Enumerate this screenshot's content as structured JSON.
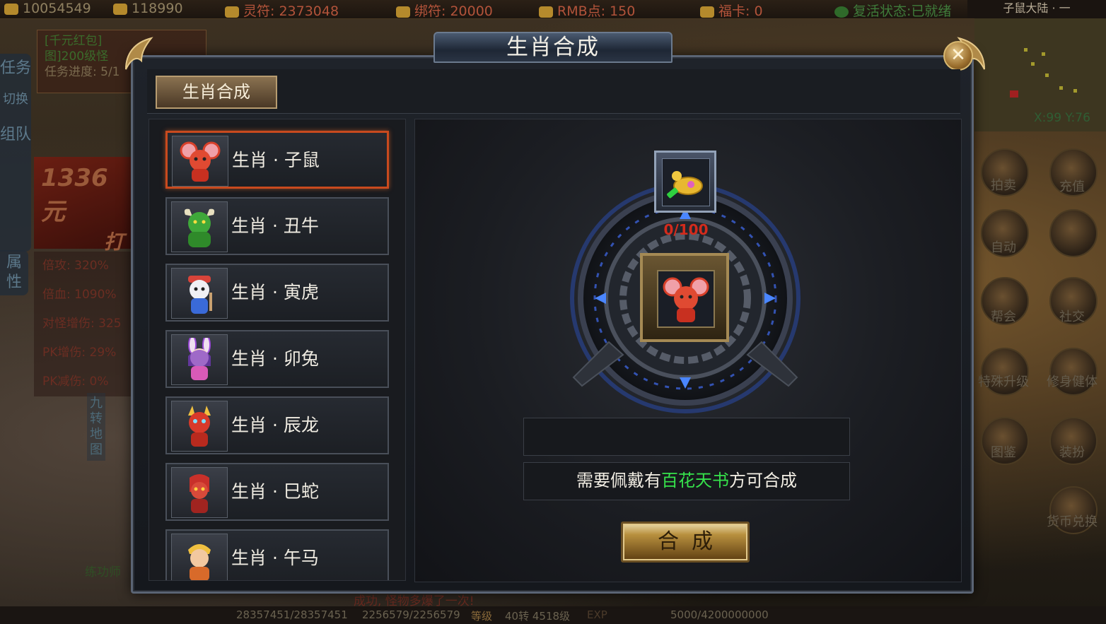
{
  "topbar": {
    "gold": "10054549",
    "ingot": "118990",
    "lingfu": "灵符: 2373048",
    "bangfu": "绑符: 20000",
    "rmb": "RMB点: 150",
    "fuka": "福卡: 0",
    "revive": "复活状态:已就绪",
    "server": "子鼠大陆 · 一"
  },
  "lefthud": {
    "btn_task": "任务",
    "btn_switch": "切换",
    "btn_team": "组队",
    "btn_attr": "属性",
    "quest_line1": "[千元红包]",
    "quest_line2": "图]200级怪",
    "quest_line3": "任务进度: 5/1",
    "banner": "1336元",
    "banner2": "打",
    "stats": [
      "倍攻: 320%",
      "倍血: 1090%",
      "对怪增伤: 325",
      "PK增伤: 29%",
      "PK减伤: 0%"
    ],
    "map_label": "九转地图",
    "chat": "练功师"
  },
  "righthud": {
    "coords": "X:99 Y:76",
    "buttons": [
      "拍卖",
      "充值",
      "自动",
      "",
      "帮会",
      "社交",
      "特殊升级",
      "修身健体",
      "图鉴",
      "装扮",
      "货币兑换"
    ]
  },
  "bottombar": {
    "hp": "28357451/28357451",
    "mp": "2256579/2256579",
    "level_label": "等级",
    "level": "40转 4518级",
    "exp_label": "EXP",
    "exp": "5000/4200000000",
    "system_msg": "成功, 怪物多爆了一次!"
  },
  "dialog": {
    "title": "生肖合成",
    "close": "✕",
    "tab": "生肖合成",
    "list": [
      {
        "label": "生肖 · 子鼠",
        "color": "#d8402a",
        "selected": true
      },
      {
        "label": "生肖 · 丑牛",
        "color": "#3fa83a",
        "selected": false
      },
      {
        "label": "生肖 · 寅虎",
        "color": "#d8443a",
        "selected": false
      },
      {
        "label": "生肖 · 卯兔",
        "color": "#9b4ad8",
        "selected": false
      },
      {
        "label": "生肖 · 辰龙",
        "color": "#d83a2a",
        "selected": false
      },
      {
        "label": "生肖 · 巳蛇",
        "color": "#c8302a",
        "selected": false
      },
      {
        "label": "生肖 · 午马",
        "color": "#d86a2a",
        "selected": false
      }
    ],
    "material_progress": "0/100",
    "requirement_prefix": "需要佩戴有",
    "requirement_item": "百花天书",
    "requirement_suffix": "方可合成",
    "synth_button": "合成"
  },
  "colors": {
    "accent_gold": "#b8903e",
    "selected_border": "#c94a1e",
    "requirement_green": "#36e14b",
    "progress_red": "#d42b1c"
  }
}
